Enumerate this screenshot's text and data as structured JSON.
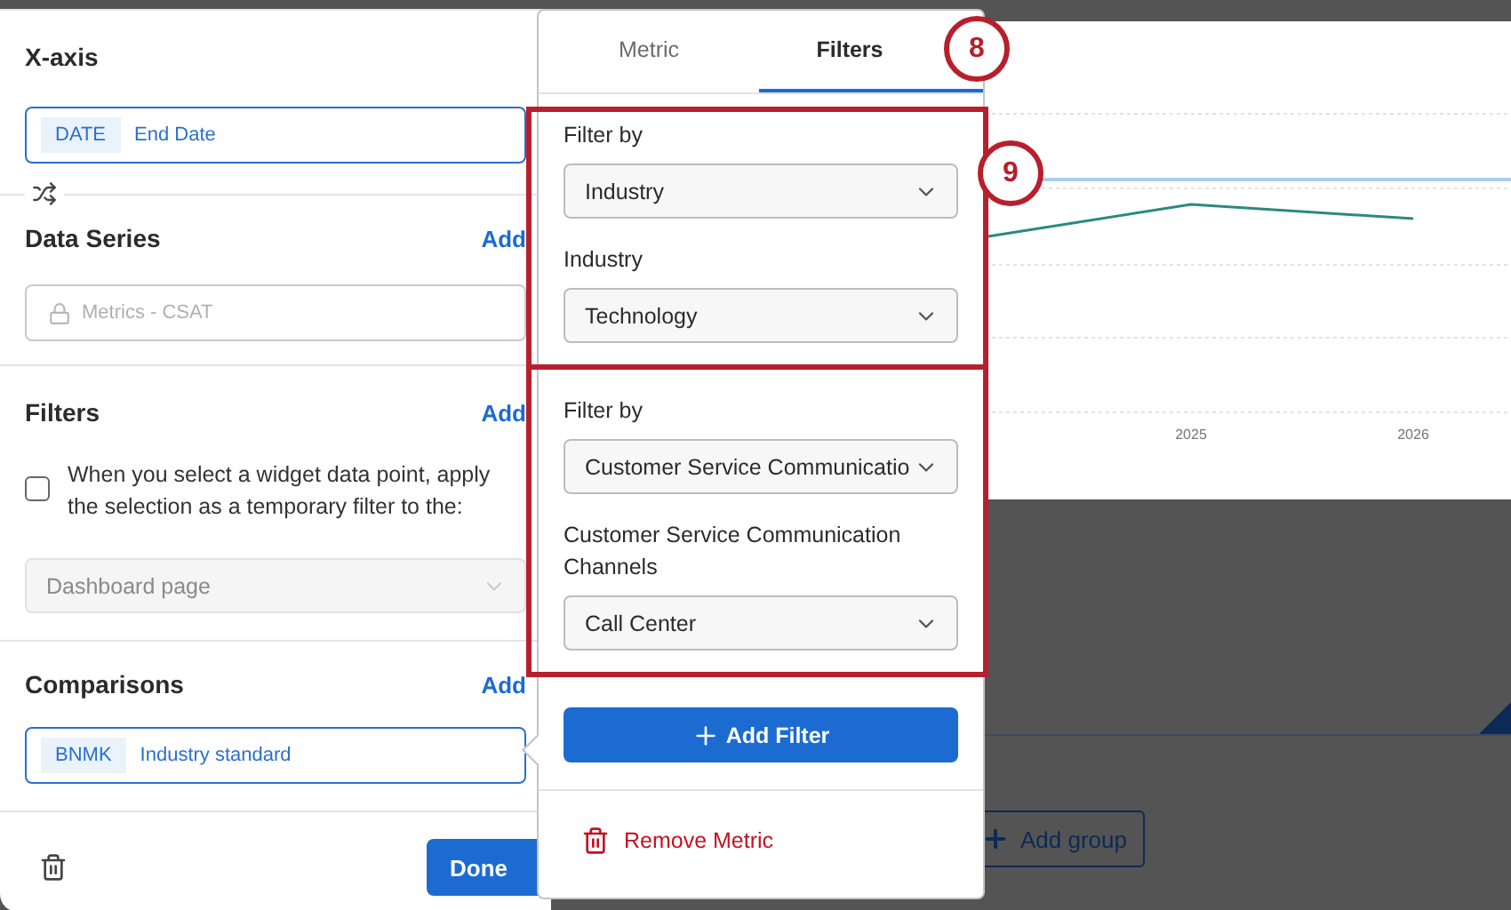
{
  "x_axis": {
    "title": "X-axis",
    "tag": "DATE",
    "value": "End Date"
  },
  "data_series": {
    "title": "Data Series",
    "add_label": "Add",
    "field": "Metrics - CSAT",
    "locked": true
  },
  "filters": {
    "title": "Filters",
    "add_label": "Add",
    "checkbox": {
      "label": "When you select a widget data point, apply the selection as a temporary filter to the:",
      "checked": false
    },
    "target_select": {
      "value": "Dashboard page",
      "disabled": true
    }
  },
  "comparisons": {
    "title": "Comparisons",
    "add_label": "Add",
    "tag": "BNMK",
    "value": "Industry standard"
  },
  "footer": {
    "done_label": "Done"
  },
  "popover": {
    "tabs": [
      {
        "label": "Metric",
        "selected": false
      },
      {
        "label": "Filters",
        "selected": true
      }
    ],
    "filter_groups": [
      {
        "filter_by_label": "Filter by",
        "filter_by_value": "Industry",
        "value_label": "Industry",
        "value": "Technology"
      },
      {
        "filter_by_label": "Filter by",
        "filter_by_value": "Customer Service Communicatio",
        "value_label": "Customer Service Communication Channels",
        "value": "Call Center"
      }
    ],
    "add_filter_label": "Add Filter",
    "remove_label": "Remove Metric"
  },
  "chart": {
    "x_labels": [
      "2025",
      "2026"
    ]
  },
  "add_group_label": "Add group",
  "callouts": [
    {
      "number": "8"
    },
    {
      "number": "9"
    }
  ]
}
